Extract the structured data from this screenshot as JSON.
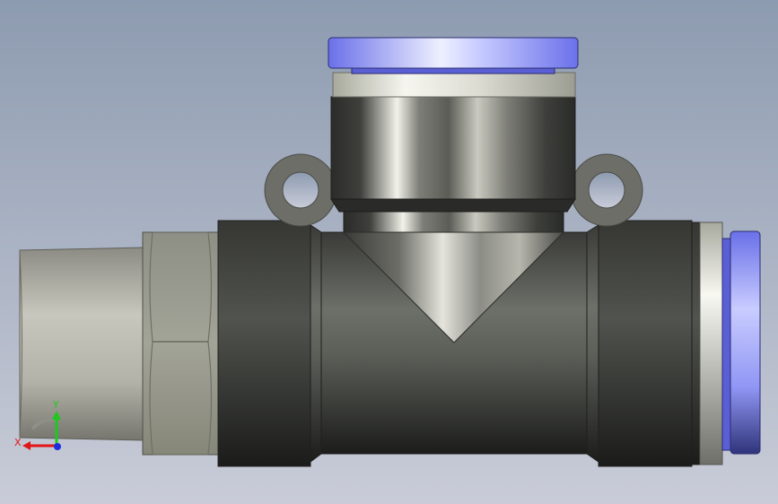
{
  "viewport": {
    "background_top": "#8d9bb0",
    "background_bottom": "#c9ccd8"
  },
  "triad": {
    "x_label": "X",
    "y_label": "Y",
    "x_color": "#e01616",
    "y_color": "#1ec81e",
    "z_color": "#1c2ee0"
  },
  "colors": {
    "body_dark": "#2e2f2c",
    "body_mid": "#6f716b",
    "metal_light": "#dcdcd2",
    "hex_face": "#9a9a8e",
    "lug": "#6d6e68",
    "collet_blue": "#7a80f0",
    "collet_blue_light": "#e6e8ff",
    "ring_white": "#f4f4ee"
  }
}
